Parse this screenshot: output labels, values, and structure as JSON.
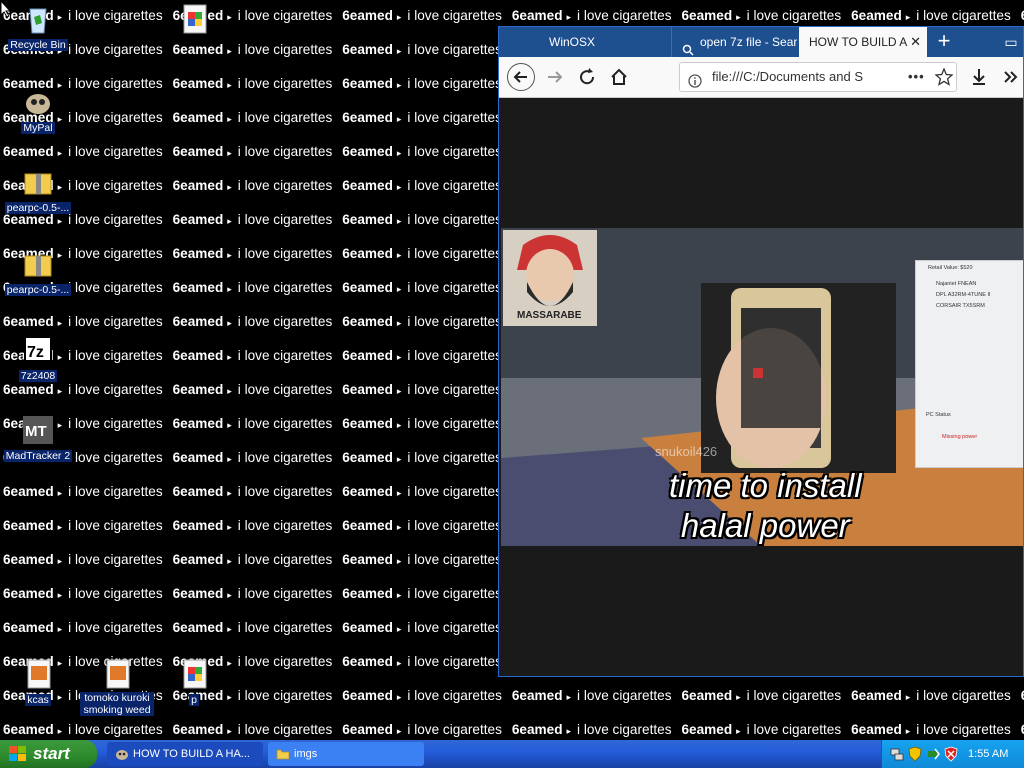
{
  "wallpaper": {
    "word_bold": "6eamed",
    "arrow": "▸",
    "word_text": "i love cigarettes"
  },
  "desktop_icons": [
    {
      "label": "Recycle Bin",
      "icon": "recycle-bin-icon"
    },
    {
      "label": "MyPal",
      "icon": "mypal-icon"
    },
    {
      "label": "pearpc-0.5-...",
      "icon": "zip-folder-icon"
    },
    {
      "label": "pearpc-0.5-...",
      "icon": "zip-folder-icon"
    },
    {
      "label": "7z2408",
      "icon": "7zip-icon"
    },
    {
      "label": "MadTracker 2",
      "icon": "madtracker-icon"
    },
    {
      "label": "kcas",
      "icon": "image-file-icon"
    },
    {
      "label": "tomoko kuroki smoking weed",
      "icon": "image-file-icon"
    },
    {
      "label": "p",
      "icon": "image-file-icon"
    },
    {
      "label": "",
      "icon": "paint-file-icon"
    }
  ],
  "browser": {
    "tabs": [
      {
        "label": "WinOSX"
      },
      {
        "label": "open 7z file - Sear"
      },
      {
        "label": "HOW TO BUILD A"
      }
    ],
    "new_tab": "+",
    "minimize": "▭",
    "url": "file:///C:/Documents and S",
    "more": "•••"
  },
  "video": {
    "caption_line1": "time to install",
    "caption_line2": "halal power",
    "watermark": "snukoil426",
    "portrait_name": "MASSARABE",
    "panel_title": "Retail Value: $520",
    "panel_items": [
      "Najaniet FNEAN",
      "DPL A32RM-4TUNE II",
      "CORSAIR TX5SRM"
    ],
    "panel_status": "PC Status",
    "panel_warning": "Missing power"
  },
  "taskbar": {
    "start_label": "start",
    "buttons": [
      {
        "label": "HOW TO BUILD A HA..."
      },
      {
        "label": "imgs"
      }
    ],
    "clock": "1:55 AM"
  },
  "colors": {
    "taskbar": "#245ddb",
    "start": "#2d8a2d",
    "tray": "#0f8ad9",
    "browser_tabbar": "#1e4f8f"
  }
}
